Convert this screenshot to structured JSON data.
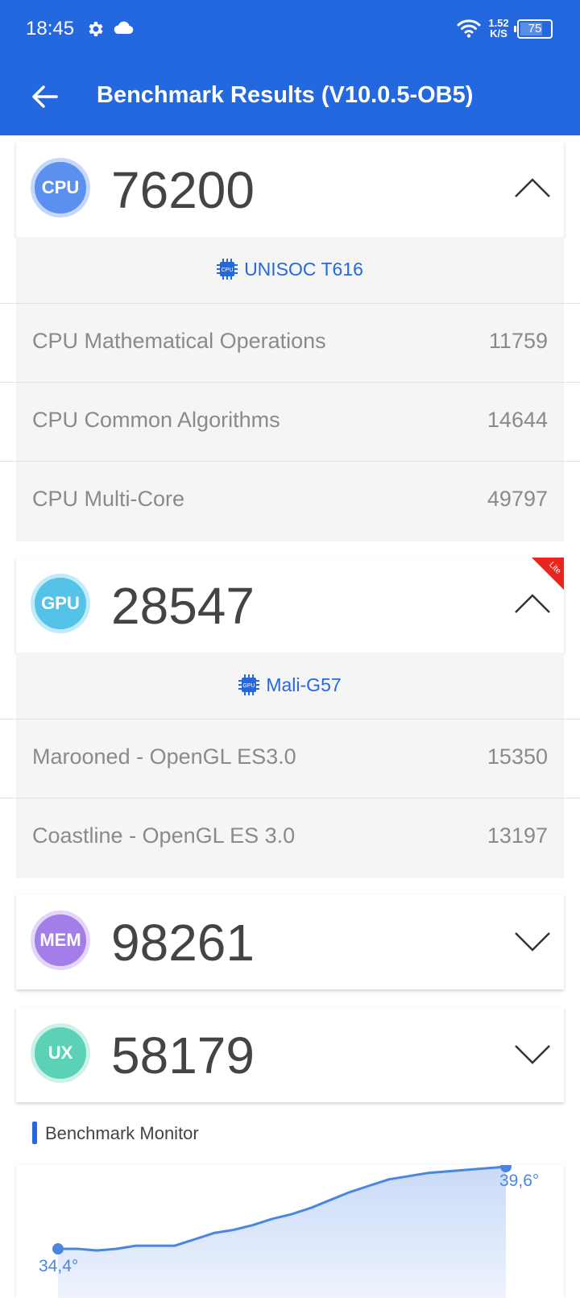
{
  "status": {
    "time": "18:45",
    "net_speed_value": "1.52",
    "net_speed_unit": "K/S",
    "battery": "75"
  },
  "app": {
    "title": "Benchmark Results (V10.0.5-OB5)"
  },
  "cpu": {
    "badge": "CPU",
    "score": "76200",
    "chip_name": "UNISOC T616",
    "chip_icon_label": "CPU",
    "rows": [
      {
        "label": "CPU Mathematical Operations",
        "value": "11759"
      },
      {
        "label": "CPU Common Algorithms",
        "value": "14644"
      },
      {
        "label": "CPU Multi-Core",
        "value": "49797"
      }
    ]
  },
  "gpu": {
    "badge": "GPU",
    "score": "28547",
    "lite_label": "Lite",
    "chip_name": "Mali-G57",
    "chip_icon_label": "GPU",
    "rows": [
      {
        "label": "Marooned - OpenGL ES3.0",
        "value": "15350"
      },
      {
        "label": "Coastline - OpenGL ES 3.0",
        "value": "13197"
      }
    ]
  },
  "mem": {
    "badge": "MEM",
    "score": "98261"
  },
  "ux": {
    "badge": "UX",
    "score": "58179"
  },
  "monitor": {
    "title": "Benchmark Monitor",
    "start_temp": "34,4°",
    "end_temp": "39,6°"
  },
  "chart_data": {
    "type": "area",
    "temperature_series": [
      34.4,
      34.4,
      34.3,
      34.4,
      34.6,
      34.6,
      34.6,
      35.0,
      35.4,
      35.6,
      35.9,
      36.3,
      36.6,
      37.0,
      37.5,
      38.0,
      38.4,
      38.8,
      39.0,
      39.2,
      39.3,
      39.4,
      39.5,
      39.6
    ]
  },
  "colors": {
    "primary": "#2468e0",
    "cpu": "#5b8ff0",
    "gpu": "#55c2e8",
    "mem": "#a37ee8",
    "ux": "#5bd1b5",
    "lite": "#e8251f"
  }
}
